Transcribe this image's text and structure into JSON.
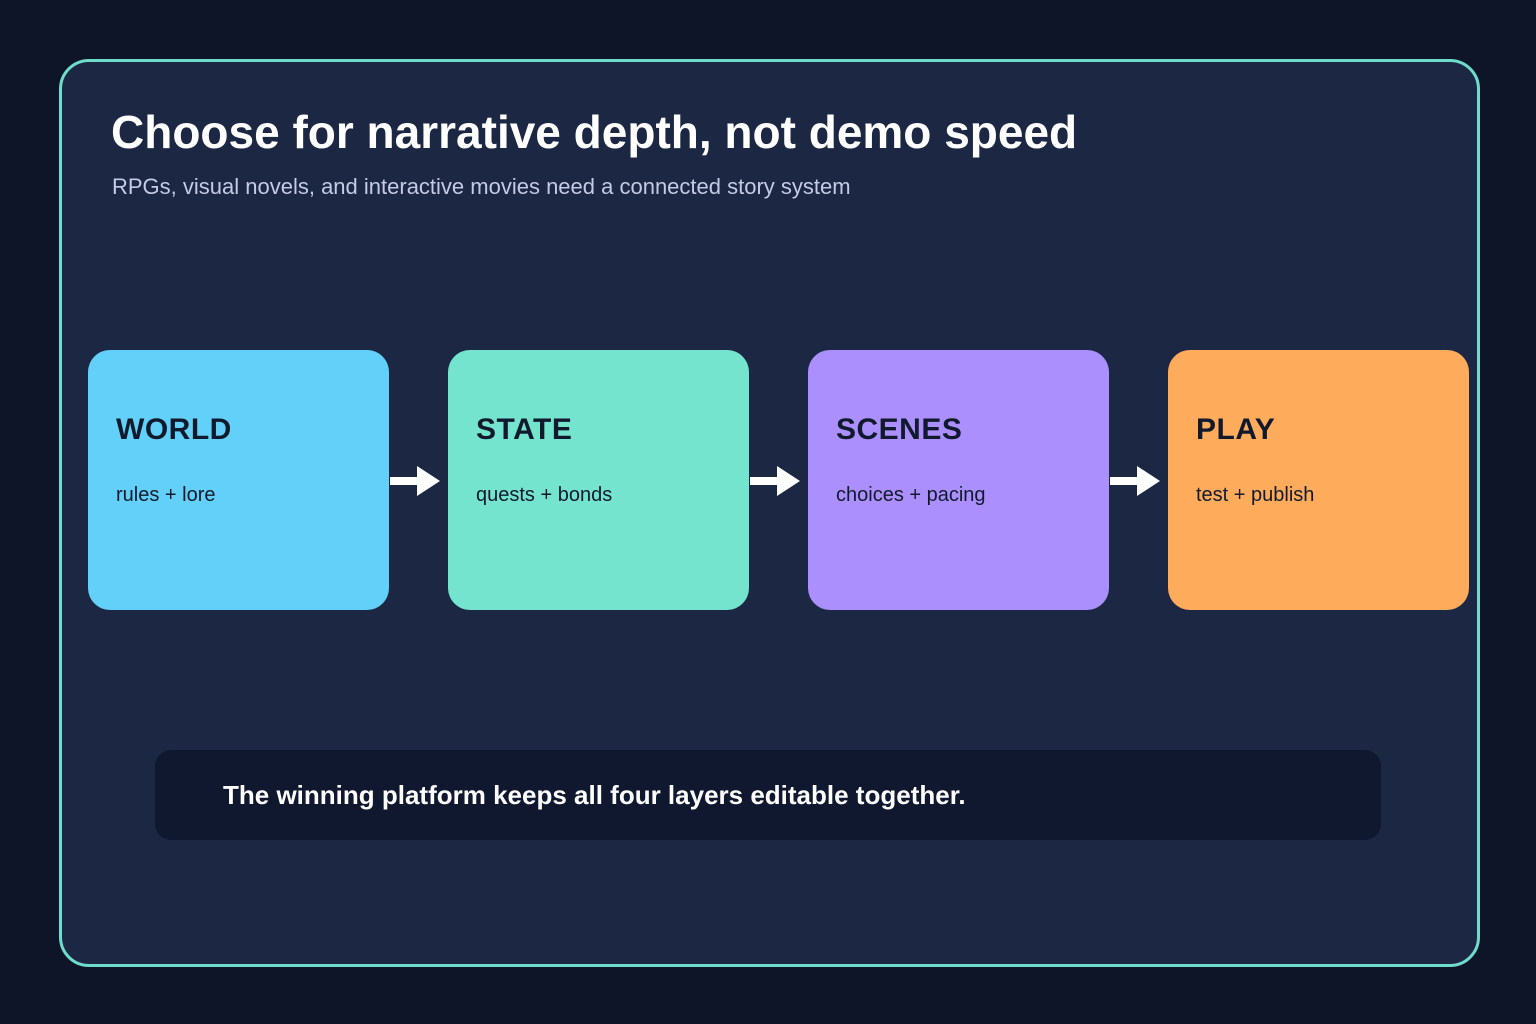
{
  "header": {
    "title": "Choose for narrative depth, not demo speed",
    "subtitle": "RPGs, visual novels, and interactive movies need a connected story system"
  },
  "flow": {
    "boxes": [
      {
        "label": "WORLD",
        "sub": "rules + lore",
        "color": "#62d0f8"
      },
      {
        "label": "STATE",
        "sub": "quests + bonds",
        "color": "#75e4cf"
      },
      {
        "label": "SCENES",
        "sub": "choices + pacing",
        "color": "#ab8ffd"
      },
      {
        "label": "PLAY",
        "sub": "test + publish",
        "color": "#ffab5c"
      }
    ],
    "arrow_color": "#ffffff"
  },
  "footer": {
    "text": "The winning platform keeps all four layers editable together."
  },
  "colors": {
    "background": "#0e1528",
    "card": "#1c2744",
    "card_border": "#6fdccb",
    "footer_bg": "#0f182e"
  }
}
